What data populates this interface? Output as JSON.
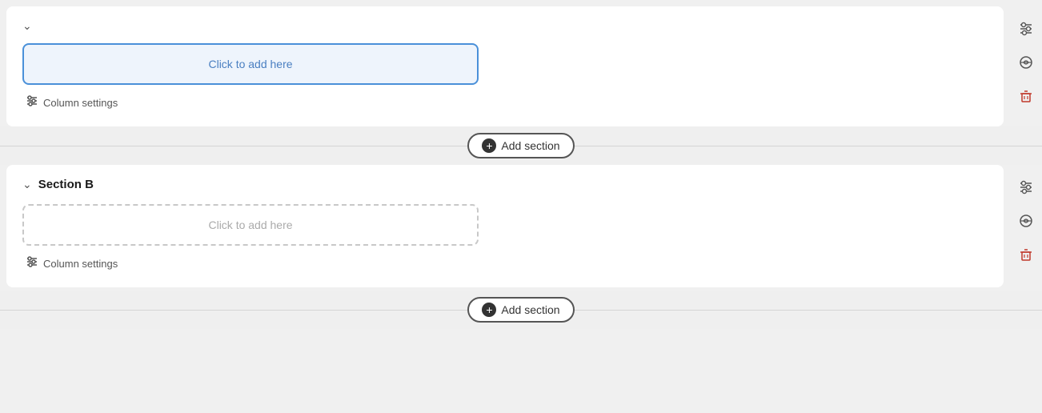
{
  "sections": [
    {
      "id": "section-top",
      "has_title": false,
      "collapsed": true,
      "chevron": "chevron-down",
      "add_here_label": "Click to add here",
      "column_settings_label": "Column settings",
      "style": "solid"
    },
    {
      "id": "section-b",
      "has_title": true,
      "title": "Section B",
      "collapsed": false,
      "chevron": "chevron-down",
      "add_here_label": "Click to add here",
      "column_settings_label": "Column settings",
      "style": "dashed"
    }
  ],
  "add_section_label": "Add section",
  "actions": {
    "settings_icon": "⊟",
    "link_icon": "⊙",
    "delete_icon": "🗑"
  },
  "top_chevron": "chevron-down"
}
